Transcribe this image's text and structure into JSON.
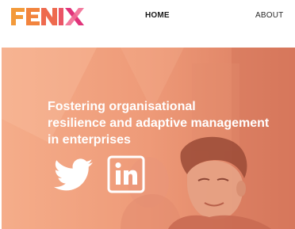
{
  "header": {
    "logo_text": "FENIX",
    "nav": {
      "home_label": "HOME",
      "about_label": "ABOUT"
    }
  },
  "hero": {
    "headline_lines": [
      "Fostering organisational",
      "resilience and adaptive management",
      "in enterprises"
    ],
    "overlay_color": "#ef9878",
    "social": [
      {
        "icon": "twitter-icon"
      },
      {
        "icon": "linkedin-icon"
      }
    ]
  },
  "colors": {
    "logo_orange": "#f08a3c",
    "logo_magenta": "#e0347a",
    "logo_pink": "#f06a8c",
    "hero_start": "#f4a37f",
    "hero_end": "#d9795c"
  }
}
